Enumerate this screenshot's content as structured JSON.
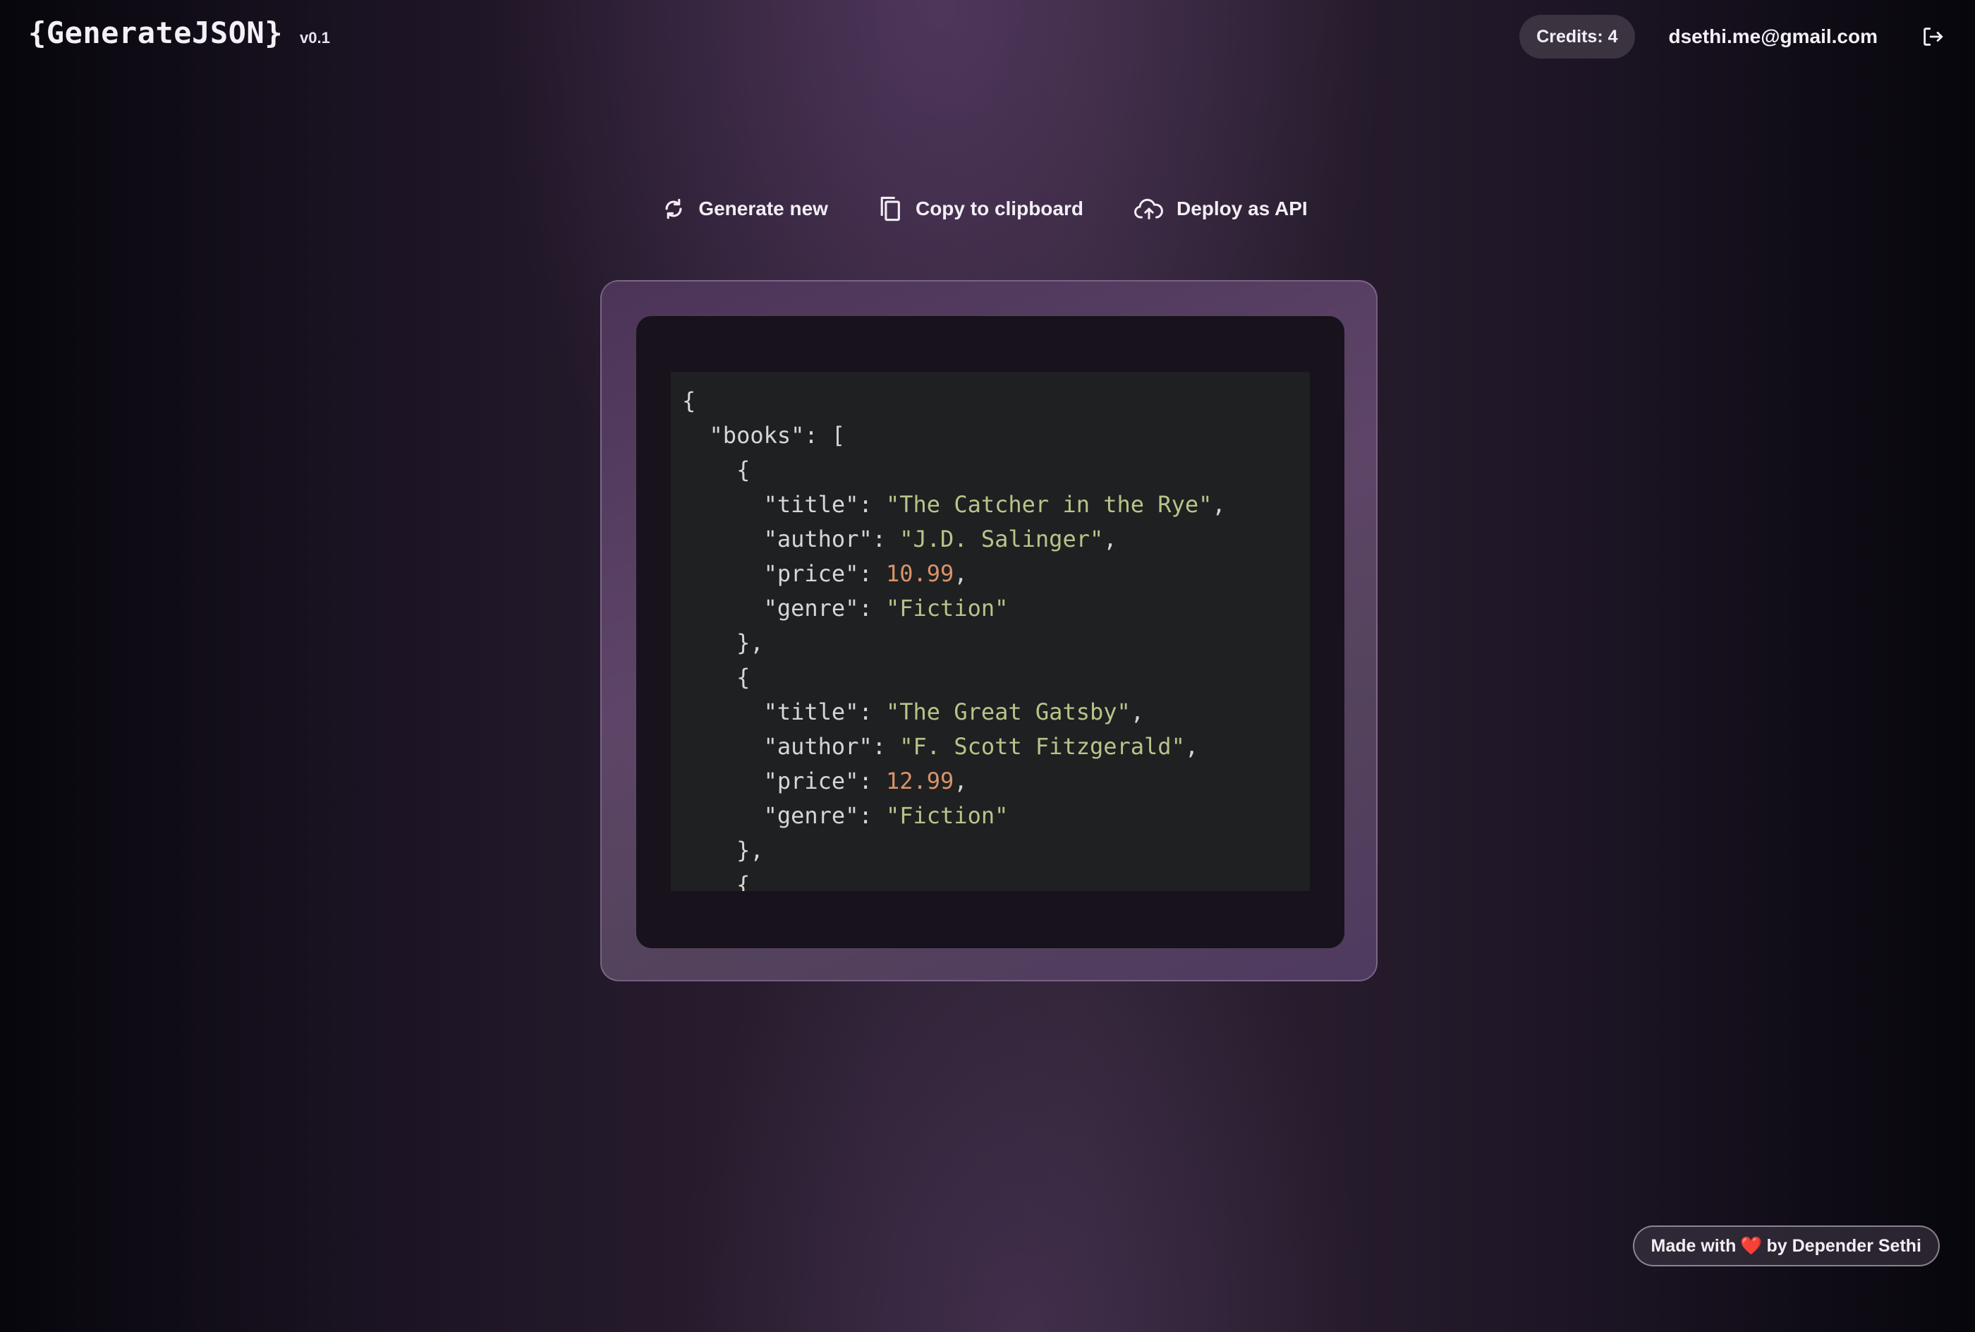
{
  "header": {
    "logo": "{GenerateJSON}",
    "version": "v0.1",
    "credits": "Credits: 4",
    "user_email": "dsethi.me@gmail.com",
    "logout_icon": "logout-icon"
  },
  "toolbar": {
    "generate_label": "Generate new",
    "generate_icon": "refresh-icon",
    "copy_label": "Copy to clipboard",
    "copy_icon": "copy-icon",
    "deploy_label": "Deploy as API",
    "deploy_icon": "cloud-upload-icon"
  },
  "json_output": {
    "lines": [
      [
        {
          "t": "{",
          "c": "punct"
        }
      ],
      [
        {
          "t": "  ",
          "c": "punct"
        },
        {
          "t": "\"books\"",
          "c": "key"
        },
        {
          "t": ": [",
          "c": "punct"
        }
      ],
      [
        {
          "t": "    {",
          "c": "punct"
        }
      ],
      [
        {
          "t": "      ",
          "c": "punct"
        },
        {
          "t": "\"title\"",
          "c": "key"
        },
        {
          "t": ": ",
          "c": "punct"
        },
        {
          "t": "\"The Catcher in the Rye\"",
          "c": "str"
        },
        {
          "t": ",",
          "c": "punct"
        }
      ],
      [
        {
          "t": "      ",
          "c": "punct"
        },
        {
          "t": "\"author\"",
          "c": "key"
        },
        {
          "t": ": ",
          "c": "punct"
        },
        {
          "t": "\"J.D. Salinger\"",
          "c": "str"
        },
        {
          "t": ",",
          "c": "punct"
        }
      ],
      [
        {
          "t": "      ",
          "c": "punct"
        },
        {
          "t": "\"price\"",
          "c": "key"
        },
        {
          "t": ": ",
          "c": "punct"
        },
        {
          "t": "10.99",
          "c": "num"
        },
        {
          "t": ",",
          "c": "punct"
        }
      ],
      [
        {
          "t": "      ",
          "c": "punct"
        },
        {
          "t": "\"genre\"",
          "c": "key"
        },
        {
          "t": ": ",
          "c": "punct"
        },
        {
          "t": "\"Fiction\"",
          "c": "str"
        }
      ],
      [
        {
          "t": "    },",
          "c": "punct"
        }
      ],
      [
        {
          "t": "    {",
          "c": "punct"
        }
      ],
      [
        {
          "t": "      ",
          "c": "punct"
        },
        {
          "t": "\"title\"",
          "c": "key"
        },
        {
          "t": ": ",
          "c": "punct"
        },
        {
          "t": "\"The Great Gatsby\"",
          "c": "str"
        },
        {
          "t": ",",
          "c": "punct"
        }
      ],
      [
        {
          "t": "      ",
          "c": "punct"
        },
        {
          "t": "\"author\"",
          "c": "key"
        },
        {
          "t": ": ",
          "c": "punct"
        },
        {
          "t": "\"F. Scott Fitzgerald\"",
          "c": "str"
        },
        {
          "t": ",",
          "c": "punct"
        }
      ],
      [
        {
          "t": "      ",
          "c": "punct"
        },
        {
          "t": "\"price\"",
          "c": "key"
        },
        {
          "t": ": ",
          "c": "punct"
        },
        {
          "t": "12.99",
          "c": "num"
        },
        {
          "t": ",",
          "c": "punct"
        }
      ],
      [
        {
          "t": "      ",
          "c": "punct"
        },
        {
          "t": "\"genre\"",
          "c": "key"
        },
        {
          "t": ": ",
          "c": "punct"
        },
        {
          "t": "\"Fiction\"",
          "c": "str"
        }
      ],
      [
        {
          "t": "    },",
          "c": "punct"
        }
      ],
      [
        {
          "t": "    {",
          "c": "punct"
        }
      ]
    ]
  },
  "footer": {
    "made_with": "Made with",
    "heart": "❤️",
    "by_author": "by Depender Sethi"
  },
  "colors": {
    "string": "#b9c38a",
    "number": "#d9936a",
    "code_bg": "#1f2021",
    "frame": "#5e4568"
  }
}
